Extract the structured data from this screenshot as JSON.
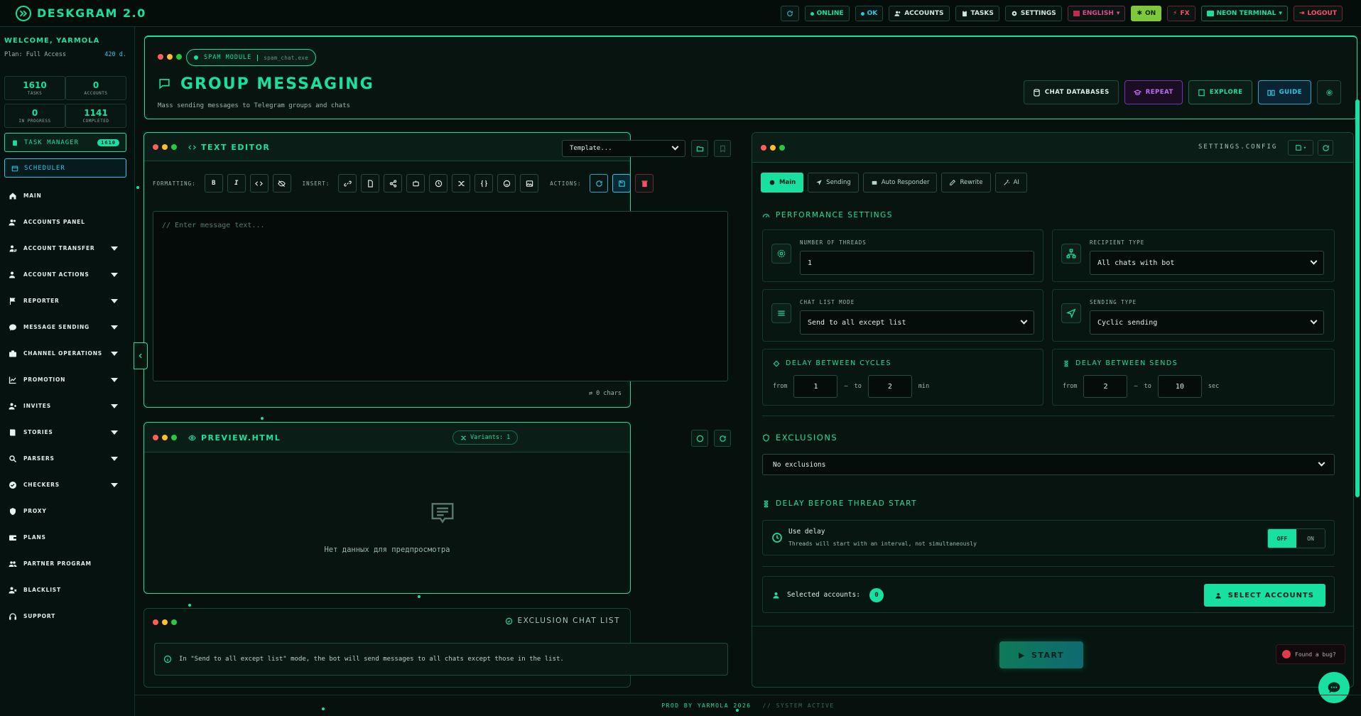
{
  "app": {
    "title": "DESKGRAM 2.0"
  },
  "topbar": {
    "online": "ONLINE",
    "ok": "OK",
    "accounts": "ACCOUNTS",
    "tasks": "TASKS",
    "settings": "SETTINGS",
    "language": "ENGLISH",
    "on": "ON",
    "fx": "FX",
    "theme": "NEON TERMINAL",
    "logout": "LOGOUT"
  },
  "sidebar": {
    "welcome": "WELCOME, YARMOLA",
    "plan": "Plan: Full Access",
    "days": "420 d.",
    "stats": [
      {
        "value": "1610",
        "label": "TASKS"
      },
      {
        "value": "0",
        "label": "ACCOUNTS"
      },
      {
        "value": "0",
        "label": "IN PROGRESS"
      },
      {
        "value": "1141",
        "label": "COMPLETED"
      }
    ],
    "task_manager": "TASK MANAGER",
    "task_badge": "1610",
    "scheduler": "SCHEDULER",
    "items": [
      {
        "label": "MAIN",
        "icon": "home-icon",
        "chevron": false
      },
      {
        "label": "ACCOUNTS PANEL",
        "icon": "users-icon",
        "chevron": false
      },
      {
        "label": "ACCOUNT TRANSFER",
        "icon": "user-transfer-icon",
        "chevron": true
      },
      {
        "label": "ACCOUNT ACTIONS",
        "icon": "user-gear-icon",
        "chevron": true
      },
      {
        "label": "REPORTER",
        "icon": "flag-icon",
        "chevron": true
      },
      {
        "label": "MESSAGE SENDING",
        "icon": "chat-icon",
        "chevron": true
      },
      {
        "label": "CHANNEL OPERATIONS",
        "icon": "briefcase-icon",
        "chevron": true
      },
      {
        "label": "PROMOTION",
        "icon": "chart-line-icon",
        "chevron": true
      },
      {
        "label": "INVITES",
        "icon": "user-plus-icon",
        "chevron": true
      },
      {
        "label": "STORIES",
        "icon": "book-icon",
        "chevron": true
      },
      {
        "label": "PARSERS",
        "icon": "search-icon",
        "chevron": true
      },
      {
        "label": "CHECKERS",
        "icon": "check-circle-icon",
        "chevron": true
      },
      {
        "label": "PROXY",
        "icon": "shield-icon",
        "chevron": false
      },
      {
        "label": "PLANS",
        "icon": "wallet-icon",
        "chevron": false
      },
      {
        "label": "PARTNER PROGRAM",
        "icon": "handshake-icon",
        "chevron": false
      },
      {
        "label": "BLACKLIST",
        "icon": "user-block-icon",
        "chevron": false
      },
      {
        "label": "SUPPORT",
        "icon": "headset-icon",
        "chevron": false
      }
    ]
  },
  "header": {
    "module": "SPAM MODULE",
    "file": "spam_chat.exe",
    "title": "GROUP MESSAGING",
    "subtitle": "Mass sending messages to Telegram groups and chats",
    "buttons": {
      "chat_databases": "CHAT DATABASES",
      "repeat": "REPEAT",
      "explore": "EXPLORE",
      "guide": "GUIDE"
    }
  },
  "editor": {
    "title": "TEXT EDITOR",
    "template_placeholder": "Template...",
    "formatting_label": "FORMATTING:",
    "insert_label": "INSERT:",
    "actions_label": "ACTIONS:",
    "bold": "B",
    "italic": "I",
    "placeholder": "// Enter message text...",
    "chars": "0 chars"
  },
  "preview": {
    "title": "PREVIEW.HTML",
    "variants": "Variants: 1",
    "empty": "Нет данных для предпросмотра"
  },
  "exclusion": {
    "title": "EXCLUSION CHAT LIST",
    "info": "In \"Send to all except list\" mode, the bot will send messages to all chats except those in the list."
  },
  "settings": {
    "config_title": "SETTINGS.CONFIG",
    "tabs": [
      "Main",
      "Sending",
      "Auto Responder",
      "Rewrite",
      "AI"
    ],
    "performance_title": "PERFORMANCE SETTINGS",
    "threads_label": "NUMBER OF THREADS",
    "threads_value": "1",
    "recipient_label": "RECIPIENT TYPE",
    "recipient_value": "All chats with bot",
    "chatlist_label": "CHAT LIST MODE",
    "chatlist_value": "Send to all except list",
    "sendtype_label": "SENDING TYPE",
    "sendtype_value": "Cyclic sending",
    "delay_cycles_title": "DELAY BETWEEN CYCLES",
    "delay_cycles": {
      "from_label": "from",
      "from": "1",
      "to_label": "to",
      "to": "2",
      "unit": "min"
    },
    "delay_sends_title": "DELAY BETWEEN SENDS",
    "delay_sends": {
      "from_label": "from",
      "from": "2",
      "to_label": "to",
      "to": "10",
      "unit": "sec"
    },
    "exclusions_title": "EXCLUSIONS",
    "exclusions_value": "No exclusions",
    "thread_delay_title": "DELAY BEFORE THREAD START",
    "use_delay": "Use delay",
    "use_delay_desc": "Threads will start with an interval, not simultaneously",
    "toggle_off": "OFF",
    "toggle_on": "ON",
    "selected_accounts_label": "Selected accounts:",
    "selected_accounts_count": "0",
    "select_accounts": "SELECT ACCOUNTS",
    "start": "START"
  },
  "bug": "Found a bug?",
  "footer": {
    "left": "PROD BY YARMOLA 2026",
    "right": "// SYSTEM ACTIVE"
  }
}
